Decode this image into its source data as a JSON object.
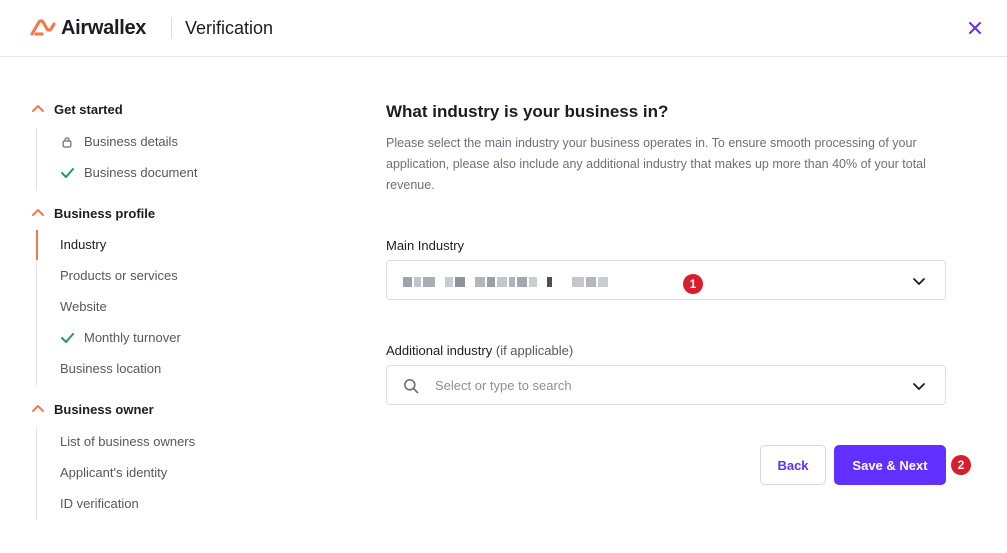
{
  "header": {
    "brand": "Airwallex",
    "title": "Verification",
    "brand_color": "#f27a4e",
    "close_icon": "close-icon"
  },
  "sidebar": {
    "sections": [
      {
        "label": "Get started",
        "items": [
          {
            "label": "Business details",
            "status": "locked",
            "icon": "lock-icon"
          },
          {
            "label": "Business document",
            "status": "complete",
            "icon": "check-icon"
          }
        ]
      },
      {
        "label": "Business profile",
        "items": [
          {
            "label": "Industry",
            "status": "active"
          },
          {
            "label": "Products or services",
            "status": "pending"
          },
          {
            "label": "Website",
            "status": "pending"
          },
          {
            "label": "Monthly turnover",
            "status": "complete",
            "icon": "check-icon"
          },
          {
            "label": "Business location",
            "status": "pending"
          }
        ]
      },
      {
        "label": "Business owner",
        "items": [
          {
            "label": "List of business owners",
            "status": "pending"
          },
          {
            "label": "Applicant's identity",
            "status": "pending"
          },
          {
            "label": "ID verification",
            "status": "pending"
          }
        ]
      }
    ]
  },
  "main": {
    "title": "What industry is your business in?",
    "description": "Please select the main industry your business operates in. To ensure smooth processing of your application, please also include any additional industry that makes up more than 40% of your total revenue.",
    "main_industry": {
      "label": "Main Industry",
      "value": "[redacted]",
      "badge": "1"
    },
    "additional_industry": {
      "label": "Additional industry",
      "label_suffix": "(if applicable)",
      "placeholder": "Select or type to search",
      "value": ""
    },
    "buttons": {
      "back": "Back",
      "next": "Save & Next",
      "next_badge": "2"
    }
  },
  "colors": {
    "accent": "#612fff",
    "brand_orange": "#f27a4e",
    "success": "#1f9d55",
    "badge_red": "#d91d2a"
  }
}
